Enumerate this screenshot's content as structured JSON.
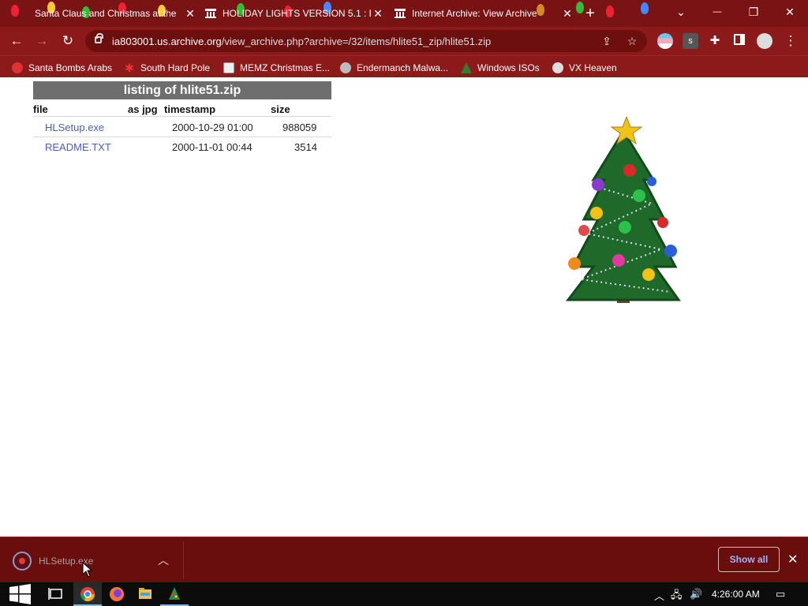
{
  "browser": {
    "tabs": [
      {
        "title": "Santa Claus and Christmas at the",
        "icon": "santa-favicon",
        "active": false
      },
      {
        "title": "HOLIDAY LIGHTS VERSION 5.1 : F",
        "icon": "archive-favicon",
        "active": false
      },
      {
        "title": "Internet Archive: View Archive",
        "icon": "archive-favicon",
        "active": true
      }
    ],
    "new_tab_label": "+",
    "url_host": "ia803001.us.archive.org",
    "url_path": "/view_archive.php?archive=/32/items/hlite51_zip/hlite51.zip",
    "window_controls": {
      "dropdown": "⌄",
      "minimize": "—",
      "restore": "❐",
      "close": "✕"
    },
    "theme_color": "#8c1a1a"
  },
  "bookmarks": [
    {
      "label": "Santa Bombs Arabs",
      "icon": "santa-icon"
    },
    {
      "label": "South Hard Pole",
      "icon": "snowflake-icon"
    },
    {
      "label": "MEMZ Christmas E...",
      "icon": "memz-icon"
    },
    {
      "label": "Endermanch Malwa...",
      "icon": "raccoon-icon"
    },
    {
      "label": "Windows ISOs",
      "icon": "tree-icon"
    },
    {
      "label": "VX Heaven",
      "icon": "vx-icon"
    }
  ],
  "listing": {
    "title": "listing of hlite51.zip",
    "columns": {
      "file": "file",
      "as_jpg": "as jpg",
      "timestamp": "timestamp",
      "size": "size"
    },
    "rows": [
      {
        "file": "HLSetup.exe",
        "timestamp": "2000-10-29 01:00",
        "size": "988059"
      },
      {
        "file": "README.TXT",
        "timestamp": "2000-11-01 00:44",
        "size": "3514"
      }
    ],
    "link_color": "#4a5fb4"
  },
  "download_shelf": {
    "filename": "HLSetup.exe",
    "show_all": "Show all",
    "close": "✕"
  },
  "taskbar": {
    "clock": "4:26:00 AM",
    "pinned": [
      "start-icon",
      "task-view-icon",
      "chrome-icon",
      "firefox-icon",
      "file-explorer-icon",
      "holiday-lights-icon"
    ]
  }
}
